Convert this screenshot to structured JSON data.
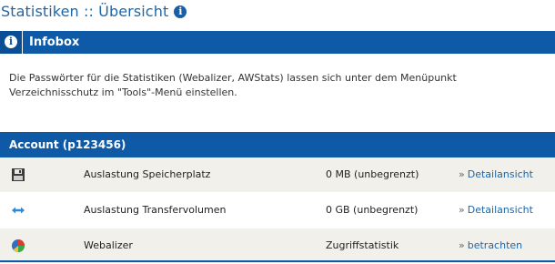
{
  "header": {
    "title": "Statistiken :: Übersicht",
    "info_icon": "info-icon"
  },
  "infobox": {
    "title": "Infobox",
    "text": "Die Passwörter für die Statistiken (Webalizer, AWStats) lassen sich unter dem Menüpunkt Verzeichnisschutz im \"Tools\"-Menü einstellen."
  },
  "account": {
    "title": "Account (p123456)",
    "rows": [
      {
        "icon": "floppy-disk-icon",
        "label": "Auslastung Speicherplatz",
        "value": "0 MB (unbegrenzt)",
        "link_prefix": "»",
        "link": "Detailansicht"
      },
      {
        "icon": "transfer-arrows-icon",
        "label": "Auslastung Transfervolumen",
        "value": "0 GB (unbegrenzt)",
        "link_prefix": "»",
        "link": "Detailansicht"
      },
      {
        "icon": "pie-chart-icon",
        "label": "Webalizer",
        "value": "Zugriffstatistik",
        "link_prefix": "»",
        "link": "betrachten"
      }
    ]
  },
  "colors": {
    "accent": "#0f5aa6",
    "link": "#1f66a8",
    "row_alt": "#f2f0ea"
  }
}
